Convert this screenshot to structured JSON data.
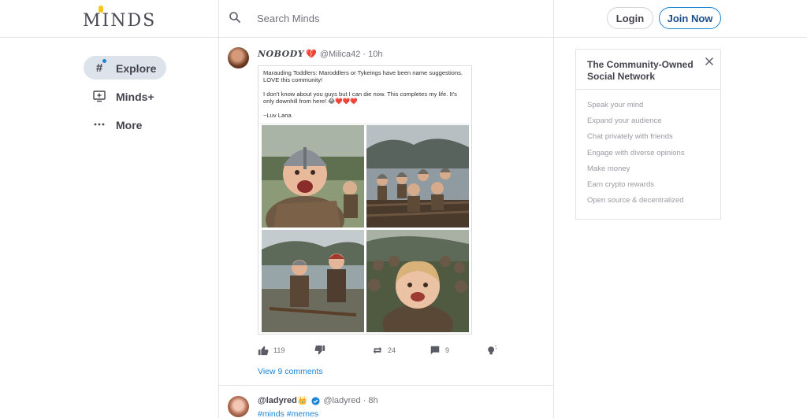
{
  "brand": {
    "name": "MINDS"
  },
  "search": {
    "placeholder": "Search Minds"
  },
  "auth": {
    "login_label": "Login",
    "join_label": "Join Now"
  },
  "nav": {
    "items": [
      {
        "label": "Explore",
        "icon": "hash-icon",
        "active": true
      },
      {
        "label": "Minds+",
        "icon": "tv-plus-icon",
        "active": false
      },
      {
        "label": "More",
        "icon": "more-dots-icon",
        "active": false
      }
    ]
  },
  "posts": [
    {
      "author_name": "NOBODY",
      "author_badge": "💔",
      "handle": "@Milica42",
      "time": "· 10h",
      "image_text": "Marauding Toddlers: Maroddlers or Tykeings have been name suggestions. LOVE this community!\n\nI don't know about you guys but I can die now. This completes my life. It's only downhill from here! 😂❤️❤️❤️\n\n~Luv Lana",
      "actions": {
        "upvotes": "119",
        "downvotes": "",
        "reminds": "24",
        "comments": "9",
        "boost": ""
      },
      "comments_link": "View 9 comments"
    },
    {
      "author_name": "@ladyred",
      "author_badge": "👑",
      "handle": "@ladyred",
      "time": "· 8h",
      "tags": "#minds #memes"
    }
  ],
  "widget": {
    "title": "The Community-Owned Social Network",
    "items": [
      "Speak your mind",
      "Expand your audience",
      "Chat privately with friends",
      "Engage with diverse opinions",
      "Make money",
      "Earn crypto rewards",
      "Open source & decentralized"
    ]
  },
  "colors": {
    "accent": "#1b85d6",
    "text": "#43434d",
    "muted": "#9a9aa3",
    "border": "#e3e4e9",
    "nav_active": "#dde3ea"
  }
}
